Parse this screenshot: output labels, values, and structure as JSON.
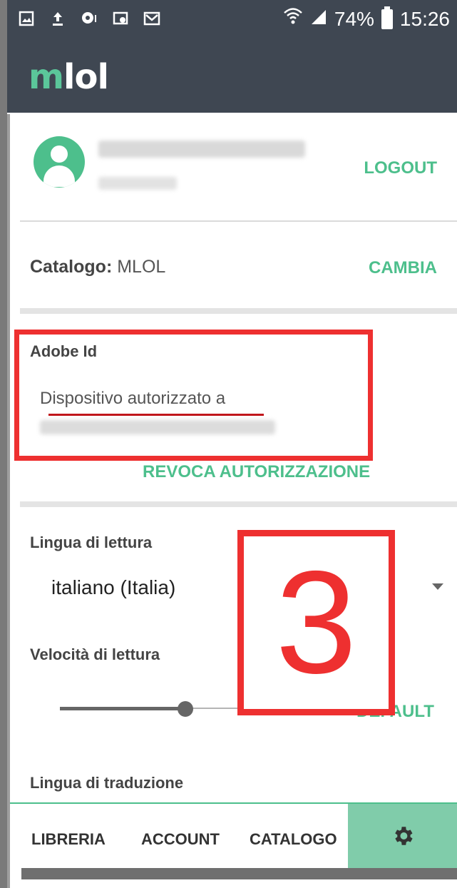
{
  "status_bar": {
    "battery": "74%",
    "time": "15:26",
    "icons": [
      "image-icon",
      "upload-icon",
      "chat-icon",
      "cast-icon",
      "mail-icon",
      "wifi-icon",
      "signal-icon",
      "battery-icon"
    ]
  },
  "app_bar": {
    "logo_m": "m",
    "logo_rest": "lol"
  },
  "account": {
    "logout": "LOGOUT"
  },
  "catalog": {
    "label": "Catalogo:",
    "value": "MLOL",
    "change": "CAMBIA"
  },
  "adobe": {
    "title": "Adobe Id",
    "status": "Dispositivo autorizzato a",
    "revoke": "REVOCA AUTORIZZAZIONE"
  },
  "reading": {
    "language_title": "Lingua di lettura",
    "language_value": "italiano (Italia)",
    "speed_title": "Velocità di lettura",
    "speed_level": 0.6,
    "default": "DEFAULT",
    "translation_title": "Lingua di traduzione"
  },
  "annotation": {
    "step_number": "3",
    "color": "#ee3030"
  },
  "bottom_nav": {
    "items": [
      "LIBRERIA",
      "ACCOUNT",
      "CATALOGO"
    ],
    "active": "settings",
    "accent": "#80ccaa"
  },
  "colors": {
    "brand_green": "#4dbf8c",
    "header": "#3f4752"
  }
}
